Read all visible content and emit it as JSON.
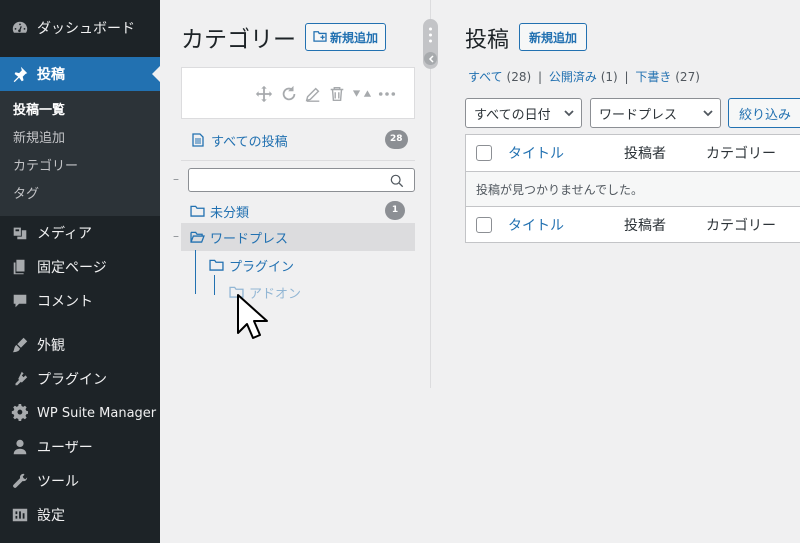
{
  "sidebar": {
    "items": [
      {
        "label": "ダッシュボード",
        "icon": "dashboard-icon"
      },
      {
        "label": "投稿",
        "icon": "pin-icon",
        "active": true
      },
      {
        "label": "メディア",
        "icon": "media-icon"
      },
      {
        "label": "固定ページ",
        "icon": "pages-icon"
      },
      {
        "label": "コメント",
        "icon": "comment-icon"
      },
      {
        "label": "外観",
        "icon": "appearance-icon"
      },
      {
        "label": "プラグイン",
        "icon": "plugin-icon"
      },
      {
        "label": "WP Suite Manager",
        "icon": "gear-icon"
      },
      {
        "label": "ユーザー",
        "icon": "user-icon"
      },
      {
        "label": "ツール",
        "icon": "wrench-icon"
      },
      {
        "label": "設定",
        "icon": "settings-icon"
      }
    ],
    "submenu": [
      "投稿一覧",
      "新規追加",
      "カテゴリー",
      "タグ"
    ]
  },
  "categories": {
    "title": "カテゴリー",
    "add_new": "新規追加",
    "all_posts": "すべての投稿",
    "all_posts_count": "28",
    "tree": [
      {
        "label": "未分類",
        "count": "1"
      },
      {
        "label": "ワードプレス"
      },
      {
        "label": "プラグイン"
      },
      {
        "label": "アドオン"
      }
    ],
    "toolbar_icons": [
      "move-icon",
      "refresh-icon",
      "edit-icon",
      "trash-icon",
      "sort-icon",
      "more-icon"
    ]
  },
  "posts": {
    "title": "投稿",
    "add_new": "新規追加",
    "filters": {
      "all": "すべて",
      "all_count": "(28)",
      "published": "公開済み",
      "published_count": "(1)",
      "draft": "下書き",
      "draft_count": "(27)",
      "sep": "|"
    },
    "date_select": "すべての日付",
    "category_select": "ワードプレス",
    "filter_button": "絞り込み",
    "columns": {
      "title": "タイトル",
      "author": "投稿者",
      "category": "カテゴリー"
    },
    "empty_message": "投稿が見つかりませんでした。"
  },
  "colors": {
    "accent": "#2271b1",
    "sidebar_bg": "#1d2327",
    "page_bg": "#f0f0f1"
  }
}
